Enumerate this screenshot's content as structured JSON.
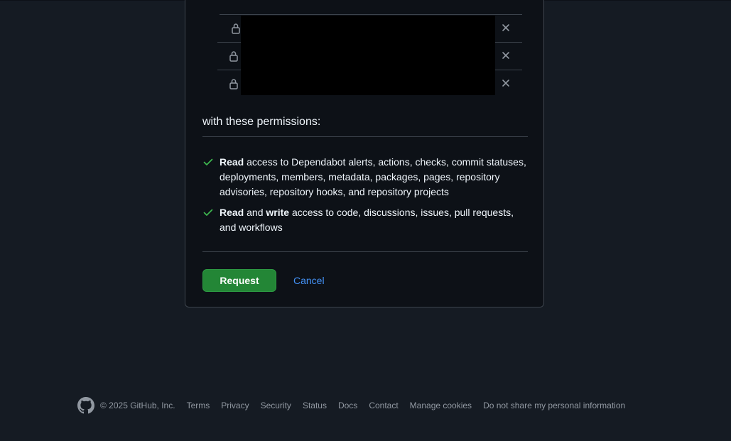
{
  "permissions": {
    "heading": "with these permissions:",
    "items": [
      {
        "strong1": "Read",
        "rest": " access to Dependabot alerts, actions, checks, commit statuses, deployments, members, metadata, packages, pages, repository advisories, repository hooks, and repository projects"
      },
      {
        "strong1": "Read",
        "mid": " and ",
        "strong2": "write",
        "rest": " access to code, discussions, issues, pull requests, and workflows"
      }
    ]
  },
  "actions": {
    "request_label": "Request",
    "cancel_label": "Cancel"
  },
  "footer": {
    "copyright": "© 2025 GitHub, Inc.",
    "links": [
      "Terms",
      "Privacy",
      "Security",
      "Status",
      "Docs",
      "Contact",
      "Manage cookies",
      "Do not share my personal information"
    ]
  },
  "icons": {
    "repo_lock": "lock-icon",
    "repo_remove": "x-icon",
    "permission": "check-icon",
    "footer_logo": "github-mark-icon"
  },
  "colors": {
    "background": "#151b23",
    "card": "#0d1117",
    "border": "#3d444d",
    "accent_green": "#238636",
    "link_blue": "#4493f8",
    "check_green": "#3fb950"
  }
}
